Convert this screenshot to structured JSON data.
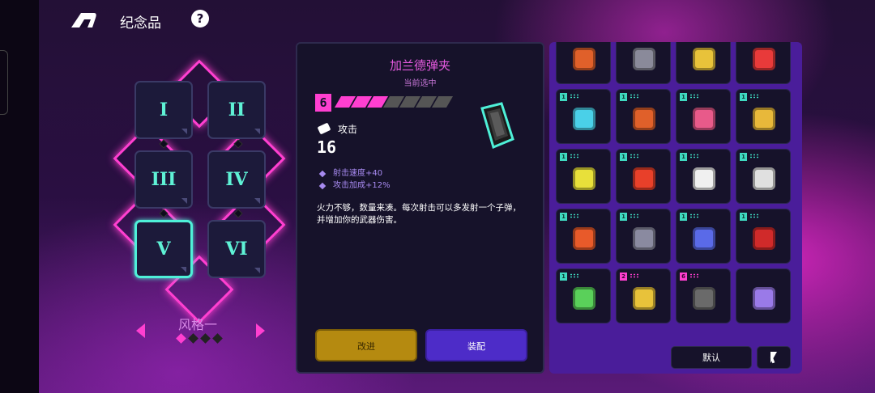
{
  "header": {
    "title": "纪念品",
    "help_label": "?"
  },
  "slots": [
    {
      "numeral": "I",
      "selected": false
    },
    {
      "numeral": "II",
      "selected": false
    },
    {
      "numeral": "III",
      "selected": false
    },
    {
      "numeral": "IV",
      "selected": false
    },
    {
      "numeral": "V",
      "selected": true
    },
    {
      "numeral": "VI",
      "selected": false
    }
  ],
  "style_selector": {
    "name": "风格一",
    "pages": 4,
    "current_page": 1
  },
  "detail": {
    "name": "加兰德弹夹",
    "status": "当前选中",
    "tier": "6",
    "pips_total": 7,
    "pips_filled": 3,
    "stat_label": "攻击",
    "stat_value": "16",
    "bonuses": [
      "射击速度+40",
      "攻击加成+12%"
    ],
    "description": "火力不够，数量来凑。每次射击可以多发射一个子弹，并增加你的武器伤害。",
    "upgrade_label": "改进",
    "equip_label": "装配"
  },
  "inventory": {
    "default_label": "默认",
    "items": [
      {
        "icon": "chest-icon",
        "badge": "",
        "color": "#e0602a"
      },
      {
        "icon": "mask-icon",
        "badge": "",
        "color": "#8a8a9a"
      },
      {
        "icon": "bottle-icon",
        "badge": "",
        "color": "#e8c23a"
      },
      {
        "icon": "racket-icon",
        "badge": "",
        "color": "#e83a3a"
      },
      {
        "icon": "pixel-console-icon",
        "badge": "1",
        "color": "#4ad0e8"
      },
      {
        "icon": "fox-icon",
        "badge": "1",
        "color": "#e0602a"
      },
      {
        "icon": "portrait-icon",
        "badge": "1",
        "color": "#e85a8a"
      },
      {
        "icon": "helmet-icon",
        "badge": "1",
        "color": "#e8b83a"
      },
      {
        "icon": "lightning-sign-icon",
        "badge": "1",
        "color": "#e8e03a"
      },
      {
        "icon": "red-card-icon",
        "badge": "1",
        "color": "#e8402a"
      },
      {
        "icon": "chicken-icon",
        "badge": "1",
        "color": "#f0f0f0"
      },
      {
        "icon": "robot-head-icon",
        "badge": "1",
        "color": "#e0e0e0"
      },
      {
        "icon": "parrot-icon",
        "badge": "1",
        "color": "#e85a2a"
      },
      {
        "icon": "spinner-top-icon",
        "badge": "1",
        "color": "#8a8aa0"
      },
      {
        "icon": "helmet-visor-icon",
        "badge": "1",
        "color": "#5a6ae8"
      },
      {
        "icon": "chili-icon",
        "badge": "1",
        "color": "#d02a2a"
      },
      {
        "icon": "green-slime-icon",
        "badge": "1",
        "color": "#5ad05a"
      },
      {
        "icon": "gold-badge-icon",
        "badge": "2",
        "color": "#e8c23a"
      },
      {
        "icon": "magazine-icon",
        "badge": "6",
        "color": "#6a6a6a"
      },
      {
        "icon": "stacked-box-icon",
        "badge": "",
        "color": "#9a7ae8"
      }
    ]
  }
}
